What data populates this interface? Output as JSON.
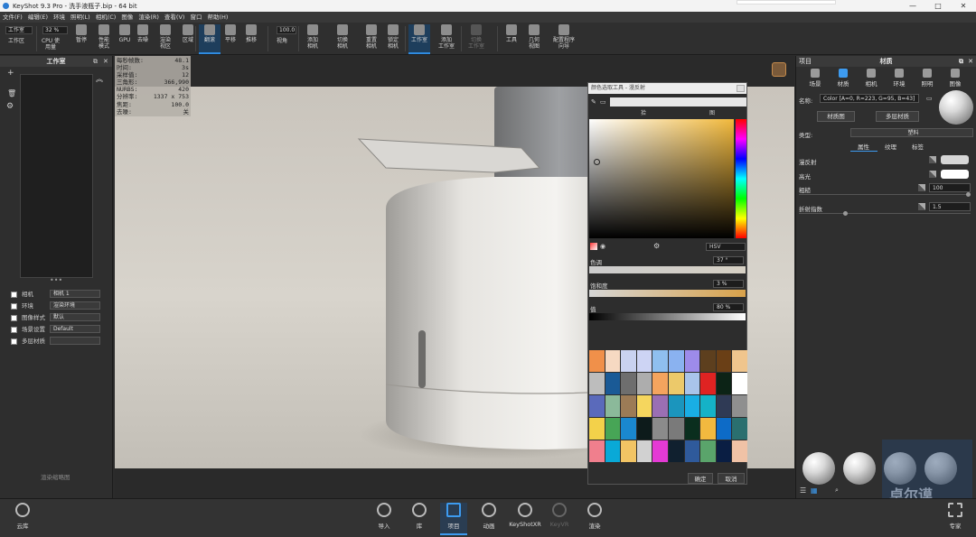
{
  "window": {
    "title": "KeyShot 9.3 Pro  - 洗手液瓶子.bip  - 64 bit",
    "minimize": "—",
    "maximize": "□",
    "close": "✕"
  },
  "menu": [
    "文件(F)",
    "编辑(E)",
    "环境",
    "照明(L)",
    "相机(C)",
    "图像",
    "渲染(R)",
    "查看(V)",
    "窗口",
    "帮助(H)"
  ],
  "toolbar": {
    "workspace_select": "工作室",
    "zoom_field": "32 %",
    "fov_field": "100.0",
    "items": [
      {
        "label": "工作区",
        "icon": "workspace-icon"
      },
      {
        "label": "CPU 使用量",
        "icon": "cpu-icon"
      },
      {
        "label": "暂停",
        "icon": "pause-icon"
      },
      {
        "label": "性能\n模式",
        "icon": "performance-icon"
      },
      {
        "label": "GPU",
        "icon": "gpu-icon"
      },
      {
        "label": "去噪",
        "icon": "denoise-icon"
      },
      {
        "label": "渲染\n视区",
        "icon": "render-region-icon"
      },
      {
        "label": "区域",
        "icon": "region-icon"
      },
      {
        "label": "翻滚",
        "icon": "tumble-icon"
      },
      {
        "label": "平移",
        "icon": "pan-icon"
      },
      {
        "label": "推移",
        "icon": "dolly-icon"
      },
      {
        "label": "视角",
        "icon": "view-angle-icon"
      },
      {
        "label": "添加\n相机",
        "icon": "add-camera-icon"
      },
      {
        "label": "切换\n相机",
        "icon": "switch-camera-icon"
      },
      {
        "label": "重置\n相机",
        "icon": "reset-camera-icon"
      },
      {
        "label": "锁定\n相机",
        "icon": "lock-camera-icon"
      },
      {
        "label": "工作室",
        "icon": "studio-icon"
      },
      {
        "label": "添加\n工作室",
        "icon": "add-studio-icon"
      },
      {
        "label": "切换\n工作室",
        "icon": "switch-studio-icon"
      },
      {
        "label": "工具",
        "icon": "tools-icon"
      },
      {
        "label": "几何\n视图",
        "icon": "geometry-view-icon"
      },
      {
        "label": "配置程序\n向导",
        "icon": "configurator-icon"
      }
    ]
  },
  "left_panel": {
    "title": "工作室",
    "rows": [
      {
        "label": "相机",
        "value": "相机 1"
      },
      {
        "label": "环境",
        "value": "渲染环境"
      },
      {
        "label": "图像样式",
        "value": "默认"
      },
      {
        "label": "场景设置",
        "value": "Default"
      },
      {
        "label": "多层材质",
        "value": ""
      }
    ],
    "footer_button": "渲染缩略图"
  },
  "stats": [
    {
      "k": "每秒帧数:",
      "v": "48.1"
    },
    {
      "k": "时间:",
      "v": "3s"
    },
    {
      "k": "采样值:",
      "v": "12"
    },
    {
      "k": "三角形:",
      "v": "366,990"
    },
    {
      "k": "NURBS:",
      "v": "420"
    },
    {
      "k": "分辨率:",
      "v": "1337 x 753"
    },
    {
      "k": "焦距:",
      "v": "100.0"
    },
    {
      "k": "去噪:",
      "v": "关"
    }
  ],
  "color_picker": {
    "title": "颜色选取工具 - 漫反射",
    "tab1": "拾",
    "tab2": "图",
    "mode": "HSV",
    "hue_label": "色调",
    "hue_value": "37 °",
    "sat_label": "饱和度",
    "sat_value": "3 %",
    "val_label": "值",
    "val_value": "80 %",
    "ok": "确定",
    "cancel": "取消",
    "swatches": [
      "#f0904a",
      "#f6d9c2",
      "#c9d2f0",
      "#cdd4f4",
      "#8fbfef",
      "#8ab2f0",
      "#9d8bea",
      "#5d3f1e",
      "#6a3f16",
      "#f0c58d",
      "#bdbdbd",
      "#1a5a96",
      "#6e6e6e",
      "#adadad",
      "#f4a45e",
      "#ecc96a",
      "#a9c4ea",
      "#df2322",
      "#0c2316",
      "#ffffff",
      "#5a6abb",
      "#8bb99a",
      "#9c7b56",
      "#f5d65e",
      "#9a6fb3",
      "#1b95bd",
      "#19aee4",
      "#15b2c7",
      "#2f3a55",
      "#8f8f8f",
      "#f3d14a",
      "#47a556",
      "#1a88cf",
      "#0d1b1b",
      "#8b8b8b",
      "#7a7a7a",
      "#0a2e1e",
      "#f2b93f",
      "#0d6bc7",
      "#2a6f6f",
      "#f07f8d",
      "#09a9d7",
      "#f2c464",
      "#d1d1d1",
      "#e43ad4",
      "#10202f",
      "#2f5a9b",
      "#5aa46b",
      "#0a1e43",
      "#f0c2a6"
    ]
  },
  "right_panel": {
    "header_left": "项目",
    "title": "材质",
    "tabs": [
      {
        "label": "场景",
        "icon": "scene-icon"
      },
      {
        "label": "材质",
        "icon": "material-icon",
        "active": true
      },
      {
        "label": "相机",
        "icon": "camera-icon"
      },
      {
        "label": "环境",
        "icon": "environment-icon"
      },
      {
        "label": "照明",
        "icon": "lighting-icon"
      },
      {
        "label": "图像",
        "icon": "image-icon"
      }
    ],
    "name_label": "名称:",
    "name_value": "Color [A=0, R=223, G=95, B=43]",
    "btn_material_graph": "材质图",
    "btn_multi_material": "多层材质",
    "type_label": "类型:",
    "type_value": "塑料",
    "subtabs": [
      "属性",
      "纹理",
      "标签"
    ],
    "props": [
      {
        "label": "漫反射",
        "value": ""
      },
      {
        "label": "高光",
        "value": ""
      },
      {
        "label": "粗糙",
        "value": "100"
      },
      {
        "label": "折射指数",
        "value": "1.5"
      }
    ]
  },
  "bottom_bar": {
    "cloud": "云库",
    "expert": "专家",
    "items": [
      {
        "label": "导入",
        "icon": "import-icon"
      },
      {
        "label": "库",
        "icon": "library-icon"
      },
      {
        "label": "项目",
        "icon": "project-icon",
        "active": true
      },
      {
        "label": "动画",
        "icon": "animation-icon"
      },
      {
        "label": "KeyShotXR",
        "icon": "keyshotxr-icon"
      },
      {
        "label": "KeyVR",
        "icon": "keyvr-icon",
        "dim": true
      },
      {
        "label": "渲染",
        "icon": "render-icon"
      }
    ]
  },
  "watermark": "卓尔谟"
}
